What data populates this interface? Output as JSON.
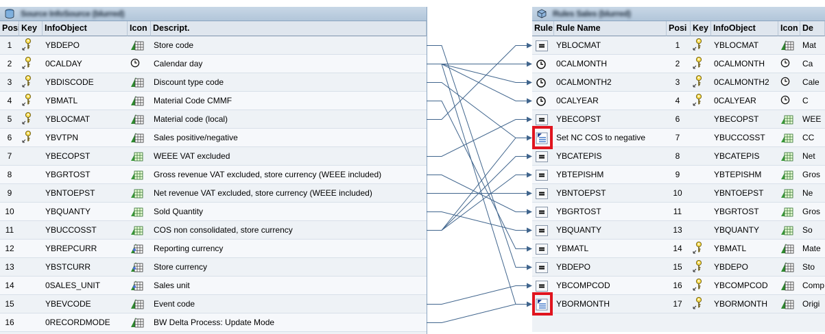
{
  "left_panel": {
    "title": "Source InfoSource (blurred)",
    "columns": {
      "pos": "Posi",
      "key": "Key",
      "infoobject": "InfoObject",
      "icon": "Icon",
      "desc": "Descript."
    },
    "rows": [
      {
        "pos": "1",
        "key": true,
        "obj": "YBDEPO",
        "icon": "characteristic-icon",
        "desc": "Store code"
      },
      {
        "pos": "2",
        "key": true,
        "obj": "0CALDAY",
        "icon": "clock-icon",
        "desc": "Calendar day"
      },
      {
        "pos": "3",
        "key": true,
        "obj": "YBDISCODE",
        "icon": "characteristic-icon",
        "desc": "Discount type code"
      },
      {
        "pos": "4",
        "key": true,
        "obj": "YBMATL",
        "icon": "characteristic-icon",
        "desc": "Material Code CMMF"
      },
      {
        "pos": "5",
        "key": true,
        "obj": "YBLOCMAT",
        "icon": "characteristic-icon",
        "desc": "Material code (local)"
      },
      {
        "pos": "6",
        "key": true,
        "obj": "YBVTPN",
        "icon": "characteristic-icon",
        "desc": "Sales positive/negative"
      },
      {
        "pos": "7",
        "key": false,
        "obj": "YBECOPST",
        "icon": "keyfigure-icon",
        "desc": "WEEE VAT excluded"
      },
      {
        "pos": "8",
        "key": false,
        "obj": "YBGRTOST",
        "icon": "keyfigure-icon",
        "desc": "Gross revenue VAT excluded, store currency (WEEE included)"
      },
      {
        "pos": "9",
        "key": false,
        "obj": "YBNTOEPST",
        "icon": "keyfigure-icon",
        "desc": "Net revenue VAT excluded, store currency (WEEE included)"
      },
      {
        "pos": "10",
        "key": false,
        "obj": "YBQUANTY",
        "icon": "keyfigure-icon",
        "desc": "Sold Quantity"
      },
      {
        "pos": "11",
        "key": false,
        "obj": "YBUCCOSST",
        "icon": "keyfigure-icon",
        "desc": "COS non consolidated, store currency"
      },
      {
        "pos": "12",
        "key": false,
        "obj": "YBREPCURR",
        "icon": "unit-icon",
        "desc": "Reporting currency"
      },
      {
        "pos": "13",
        "key": false,
        "obj": "YBSTCURR",
        "icon": "unit-icon",
        "desc": "Store currency"
      },
      {
        "pos": "14",
        "key": false,
        "obj": "0SALES_UNIT",
        "icon": "unit-icon",
        "desc": "Sales unit"
      },
      {
        "pos": "15",
        "key": false,
        "obj": "YBEVCODE",
        "icon": "characteristic-icon",
        "desc": "Event code"
      },
      {
        "pos": "16",
        "key": false,
        "obj": "0RECORDMODE",
        "icon": "characteristic-icon",
        "desc": "BW Delta Process: Update Mode"
      }
    ]
  },
  "right_panel": {
    "title": "Rules Sales (blurred)",
    "columns": {
      "rule": "Rule",
      "rule_name": "Rule Name",
      "pos": "Posi",
      "key": "Key",
      "infoobject": "InfoObject",
      "icon": "Icon",
      "desc": "De"
    },
    "rows": [
      {
        "rule": "equals-rule-icon",
        "name": "YBLOCMAT",
        "pos": "1",
        "key": true,
        "obj": "YBLOCMAT",
        "icon": "characteristic-icon",
        "desc": "Mat"
      },
      {
        "rule": "clock-rule-icon",
        "name": "0CALMONTH",
        "pos": "2",
        "key": true,
        "obj": "0CALMONTH",
        "icon": "clock-icon",
        "desc": "Ca"
      },
      {
        "rule": "clock-rule-icon",
        "name": "0CALMONTH2",
        "pos": "3",
        "key": true,
        "obj": "0CALMONTH2",
        "icon": "clock-icon",
        "desc": "Cale"
      },
      {
        "rule": "clock-rule-icon",
        "name": "0CALYEAR",
        "pos": "4",
        "key": true,
        "obj": "0CALYEAR",
        "icon": "clock-icon",
        "desc": "C"
      },
      {
        "rule": "equals-rule-icon",
        "name": "YBECOPST",
        "pos": "6",
        "key": false,
        "obj": "YBECOPST",
        "icon": "keyfigure-icon",
        "desc": "WEE"
      },
      {
        "rule": "routine-rule-icon",
        "name": "Set NC COS to negative",
        "pos": "7",
        "key": false,
        "obj": "YBUCCOSST",
        "icon": "keyfigure-icon",
        "desc": "CC"
      },
      {
        "rule": "equals-rule-icon",
        "name": "YBCATEPIS",
        "pos": "8",
        "key": false,
        "obj": "YBCATEPIS",
        "icon": "keyfigure-icon",
        "desc": "Net"
      },
      {
        "rule": "equals-rule-icon",
        "name": "YBTEPISHM",
        "pos": "9",
        "key": false,
        "obj": "YBTEPISHM",
        "icon": "keyfigure-icon",
        "desc": "Gros"
      },
      {
        "rule": "equals-rule-icon",
        "name": "YBNTOEPST",
        "pos": "10",
        "key": false,
        "obj": "YBNTOEPST",
        "icon": "keyfigure-icon",
        "desc": "Ne"
      },
      {
        "rule": "equals-rule-icon",
        "name": "YBGRTOST",
        "pos": "11",
        "key": false,
        "obj": "YBGRTOST",
        "icon": "keyfigure-icon",
        "desc": "Gros"
      },
      {
        "rule": "equals-rule-icon",
        "name": "YBQUANTY",
        "pos": "13",
        "key": false,
        "obj": "YBQUANTY",
        "icon": "keyfigure-icon",
        "desc": "So"
      },
      {
        "rule": "equals-rule-icon",
        "name": "YBMATL",
        "pos": "14",
        "key": true,
        "obj": "YBMATL",
        "icon": "characteristic-icon",
        "desc": "Mate"
      },
      {
        "rule": "equals-rule-icon",
        "name": "YBDEPO",
        "pos": "15",
        "key": true,
        "obj": "YBDEPO",
        "icon": "characteristic-icon",
        "desc": "Sto"
      },
      {
        "rule": "equals-rule-icon",
        "name": "YBCOMPCOD",
        "pos": "16",
        "key": true,
        "obj": "YBCOMPCOD",
        "icon": "characteristic-icon",
        "desc": "Comp"
      },
      {
        "rule": "routine-rule-icon",
        "name": "YBORMONTH",
        "pos": "17",
        "key": true,
        "obj": "YBORMONTH",
        "icon": "characteristic-icon",
        "desc": "Origi"
      }
    ]
  },
  "connections": [
    [
      1,
      13
    ],
    [
      2,
      2
    ],
    [
      2,
      3
    ],
    [
      2,
      4
    ],
    [
      2,
      15
    ],
    [
      3,
      6
    ],
    [
      4,
      12
    ],
    [
      5,
      1
    ],
    [
      7,
      5
    ],
    [
      8,
      10
    ],
    [
      9,
      9
    ],
    [
      10,
      11
    ],
    [
      11,
      6
    ],
    [
      11,
      7
    ],
    [
      11,
      8
    ],
    [
      15,
      14
    ],
    [
      16,
      15
    ]
  ],
  "colors": {
    "highlight": "#e0141e",
    "line": "#40658d",
    "header_bg": "#dfe6ee",
    "panel_bg": "#eef2f6"
  }
}
